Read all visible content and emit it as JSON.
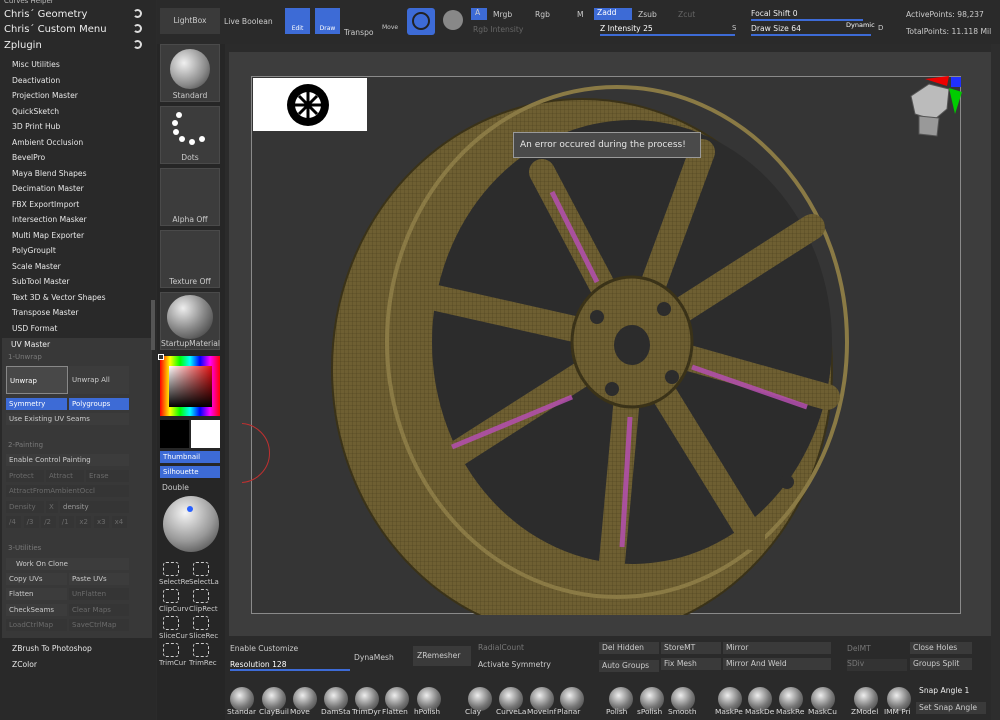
{
  "left_panel": {
    "header_partial": "Curves Helper",
    "headers": [
      "Chris´ Geometry",
      "Chris´ Custom Menu",
      "Zplugin"
    ],
    "plugins": [
      "Misc Utilities",
      "Deactivation",
      "Projection Master",
      "QuickSketch",
      "3D Print Hub",
      "Ambient Occlusion",
      "BevelPro",
      "Maya Blend Shapes",
      "Decimation Master",
      "FBX ExportImport",
      "Intersection Masker",
      "Multi Map Exporter",
      "PolyGroupIt",
      "Scale Master",
      "SubTool Master",
      "Text 3D & Vector Shapes",
      "Transpose Master",
      "USD Format"
    ],
    "uv_master": {
      "title": "UV Master",
      "sec1": "1-Unwrap",
      "unwrap": "Unwrap",
      "unwrap_all": "Unwrap All",
      "symmetry": "Symmetry",
      "polygroups": "Polygroups",
      "use_seams": "Use Existing UV Seams",
      "sec2": "2-Painting",
      "enable_cp": "Enable Control Painting",
      "protect": "Protect",
      "attract": "Attract",
      "erase": "Erase",
      "attract_ao": "AttractFromAmbientOccl",
      "density": "Density",
      "x": "X",
      "density_val": "density",
      "mults": [
        "/4",
        "/3",
        "/2",
        "/1",
        "x2",
        "x3",
        "x4"
      ],
      "sec3": "3-Utilities",
      "work_clone": "Work On Clone",
      "copy_uvs": "Copy UVs",
      "paste_uvs": "Paste UVs",
      "flatten": "Flatten",
      "unflatten": "UnFlatten",
      "checkseams": "CheckSeams",
      "clear_maps": "Clear Maps",
      "load_ctrl": "LoadCtrlMap",
      "save_ctrl": "SaveCtrlMap"
    },
    "footer": [
      "ZBrush To Photoshop",
      "ZColor"
    ]
  },
  "tray": {
    "standard": "Standard",
    "dots": "Dots",
    "alpha": "Alpha Off",
    "texture": "Texture Off",
    "material": "StartupMaterial",
    "thumbnail": "Thumbnail",
    "silhouette": "Silhouette",
    "double": "Double",
    "tools": [
      [
        "SelectRe",
        "SelectLa"
      ],
      [
        "ClipCurv",
        "ClipRect"
      ],
      [
        "SliceCur",
        "SliceRec"
      ],
      [
        "TrimCur",
        "TrimRec"
      ]
    ]
  },
  "top": {
    "lightbox": "LightBox",
    "live_boolean": "Live Boolean",
    "edit": "Edit",
    "draw": "Draw",
    "transpose": "Transpo",
    "move": "Move",
    "a": "A",
    "mrgb": "Mrgb",
    "rgb": "Rgb",
    "m": "M",
    "zadd": "Zadd",
    "zsub": "Zsub",
    "zcut": "Zcut",
    "rgb_intensity": "Rgb Intensity",
    "z_intensity": "Z Intensity 25",
    "focal_shift": "Focal Shift 0",
    "draw_size": "Draw Size 64",
    "dynamic": "Dynamic",
    "active_points": "ActivePoints: 98,237",
    "total_points": "TotalPoints: 11.118 Mil",
    "s": "S",
    "d": "D"
  },
  "viewport": {
    "error": "An error occured during the process!"
  },
  "bottom": {
    "enable_customize": "Enable Customize",
    "resolution": "Resolution 128",
    "dynamesh": "DynaMesh",
    "zremesher": "ZRemesher",
    "radial_count": "RadialCount",
    "activate_symmetry": "Activate Symmetry",
    "del_hidden": "Del Hidden",
    "auto_groups": "Auto Groups",
    "store_mt": "StoreMT",
    "fix_mesh": "Fix Mesh",
    "mirror": "Mirror",
    "mirror_weld": "Mirror And Weld",
    "del_mt": "DelMT",
    "sdiv": "SDiv",
    "close_holes": "Close Holes",
    "groups_split": "Groups Split",
    "snap_angle": "Snap Angle 1",
    "set_snap": "Set Snap Angle",
    "brushes": [
      "Standar",
      "ClayBuil",
      "Move",
      "DamSta",
      "TrimDyr",
      "Flatten",
      "hPolish",
      "Clay",
      "CurveLa",
      "MoveInf",
      "Planar",
      "Polish",
      "sPolish",
      "Smooth",
      "MaskPe",
      "MaskDe",
      "MaskRe",
      "MaskCu",
      "ZModel",
      "IMM Pri"
    ]
  },
  "colors": {
    "accent": "#3d6bd6",
    "wheel": "#7a6a3a",
    "polygroup": "#b54fb0"
  }
}
